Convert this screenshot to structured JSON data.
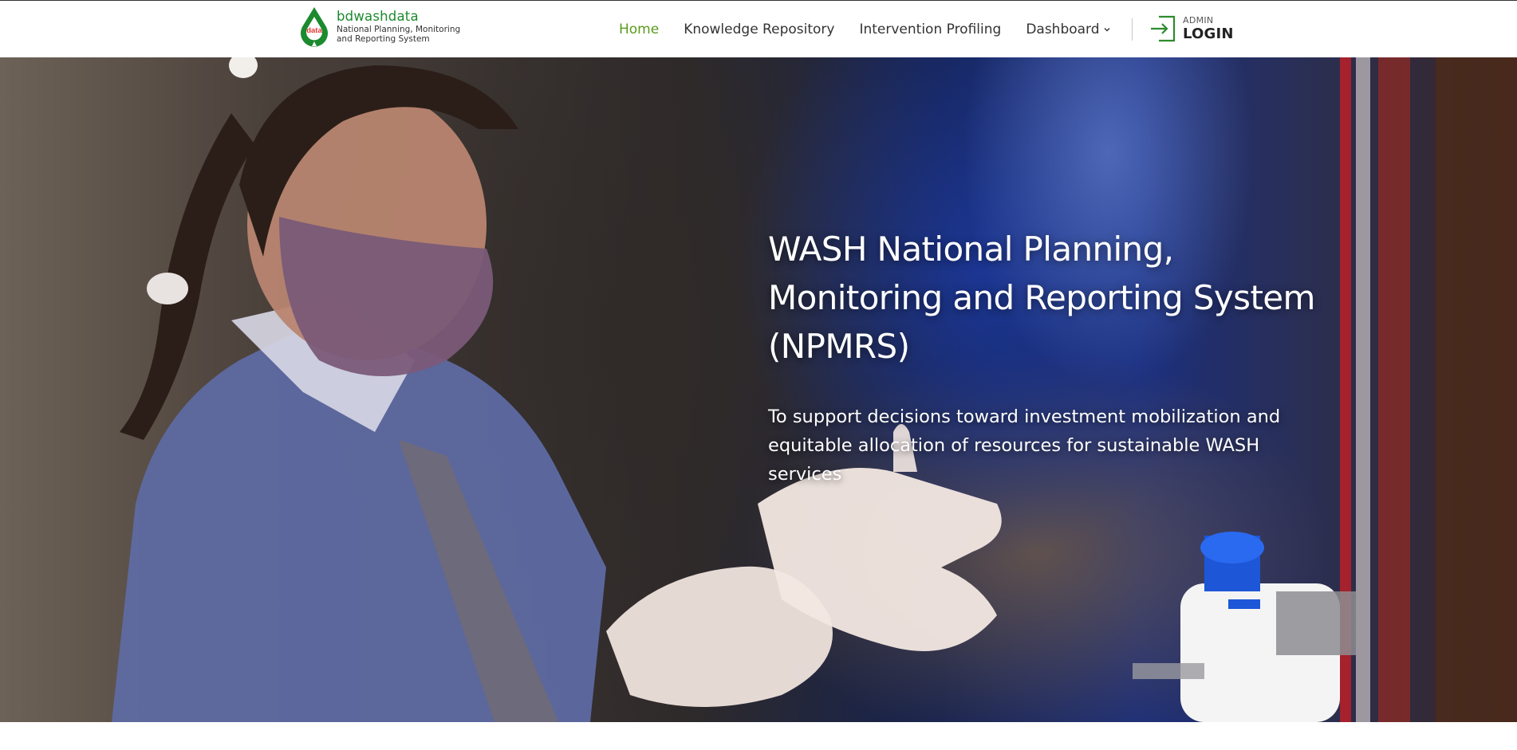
{
  "brand": {
    "logo_text": "data",
    "name": "bdwashdata",
    "subtitle": "National Planning, Monitoring and Reporting System"
  },
  "nav": {
    "items": [
      {
        "label": "Home",
        "active": true
      },
      {
        "label": "Knowledge Repository",
        "active": false
      },
      {
        "label": "Intervention Profiling",
        "active": false
      },
      {
        "label": "Dashboard",
        "active": false,
        "has_dropdown": true
      }
    ]
  },
  "login": {
    "small_label": "ADMIN",
    "label": "LOGIN"
  },
  "hero": {
    "title": "WASH National Planning, Monitoring and Reporting System (NPMRS)",
    "subtitle": "To support decisions toward investment mobilization and equitable allocation of resources for sustainable WASH services"
  },
  "colors": {
    "brand_green": "#1c8a2e",
    "nav_active": "#5a9a1a",
    "nav_text": "#333333",
    "hero_text": "#ffffff"
  },
  "icons": {
    "logo": "water-drop-logo-icon",
    "dropdown": "chevron-down-icon",
    "login": "sign-in-icon"
  }
}
